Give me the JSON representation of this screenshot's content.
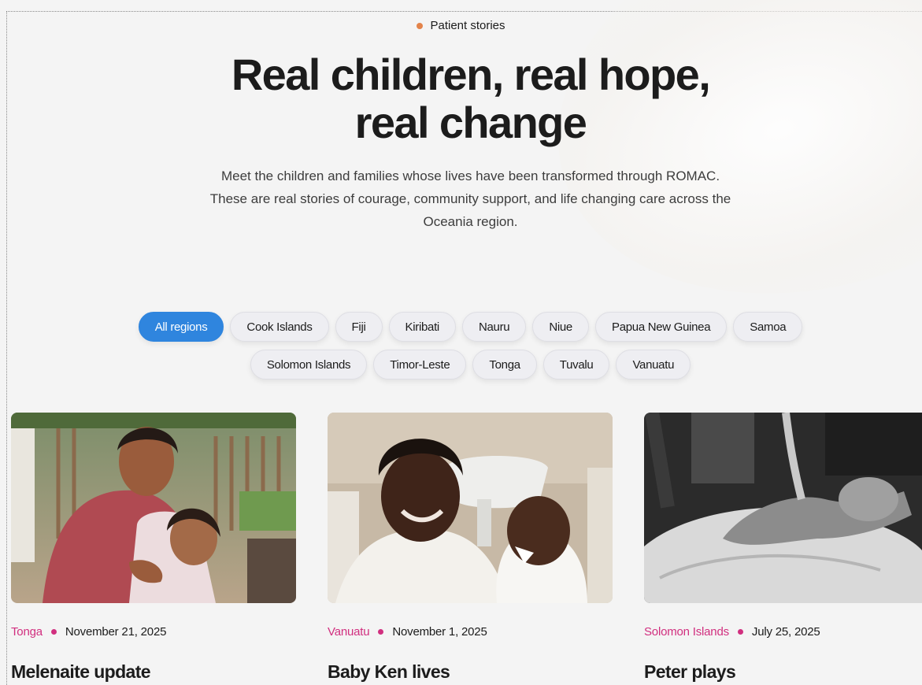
{
  "eyebrow": {
    "label": "Patient stories",
    "dot_color": "#e3834a"
  },
  "hero": {
    "title_line1": "Real children, real hope,",
    "title_line2": "real change",
    "subtitle": "Meet the children and families whose lives have been transformed through ROMAC. These are real stories of courage, community support, and life changing care across the Oceania region."
  },
  "filters": {
    "active_color": "#2f85de",
    "items": [
      {
        "label": "All regions",
        "active": true
      },
      {
        "label": "Cook Islands",
        "active": false
      },
      {
        "label": "Fiji",
        "active": false
      },
      {
        "label": "Kiribati",
        "active": false
      },
      {
        "label": "Nauru",
        "active": false
      },
      {
        "label": "Niue",
        "active": false
      },
      {
        "label": "Papua New Guinea",
        "active": false
      },
      {
        "label": "Samoa",
        "active": false
      },
      {
        "label": "Solomon Islands",
        "active": false
      },
      {
        "label": "Timor-Leste",
        "active": false
      },
      {
        "label": "Tonga",
        "active": false
      },
      {
        "label": "Tuvalu",
        "active": false
      },
      {
        "label": "Vanuatu",
        "active": false
      }
    ]
  },
  "stories": {
    "accent_color": "#d12f7f",
    "items": [
      {
        "region": "Tonga",
        "date": "November 21, 2025",
        "title": "Melenaite update",
        "photo": "photo of a smiling woman holding a laughing toddler outdoors"
      },
      {
        "region": "Vanuatu",
        "date": "November 1, 2025",
        "title": "Baby Ken lives",
        "photo": "photo of a smiling woman holding a baby with a nasal tube"
      },
      {
        "region": "Solomon Islands",
        "date": "July 25, 2025",
        "title": "Peter plays",
        "photo": "black and white photo of a patient on a hospital bed during treatment"
      }
    ]
  }
}
